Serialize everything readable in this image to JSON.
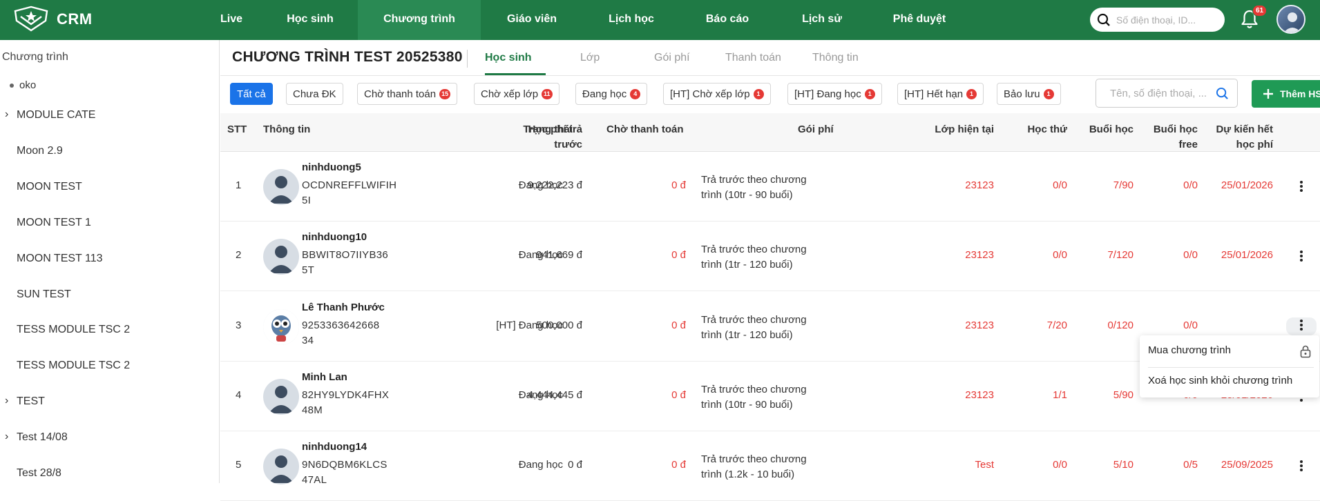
{
  "app": {
    "brand": "CRM"
  },
  "nav": {
    "items": [
      {
        "label": "Live"
      },
      {
        "label": "Học sinh"
      },
      {
        "label": "Chương trình"
      },
      {
        "label": "Giáo viên"
      },
      {
        "label": "Lịch học"
      },
      {
        "label": "Báo cáo"
      },
      {
        "label": "Lịch sử"
      },
      {
        "label": "Phê duyệt"
      }
    ],
    "active": "Chương trình",
    "search_placeholder": "Số điện thoại, ID...",
    "notification_count": "61"
  },
  "sidebar": {
    "title": "Chương trình",
    "sub": "oko",
    "items": [
      {
        "label": "MODULE CATE",
        "expandable": true
      },
      {
        "label": "Moon 2.9",
        "expandable": false
      },
      {
        "label": "MOON TEST",
        "expandable": false
      },
      {
        "label": "MOON TEST 1",
        "expandable": false
      },
      {
        "label": "MOON TEST 113",
        "expandable": false
      },
      {
        "label": "SUN TEST",
        "expandable": false
      },
      {
        "label": "TESS MODULE TSC 2",
        "expandable": false
      },
      {
        "label": "TESS MODULE TSC 2",
        "expandable": false
      },
      {
        "label": "TEST",
        "expandable": true
      },
      {
        "label": "Test 14/08",
        "expandable": true
      },
      {
        "label": "Test 28/8",
        "expandable": false
      }
    ]
  },
  "program": {
    "title": "CHƯƠNG TRÌNH TEST 20525380",
    "tabs": [
      {
        "label": "Học sinh"
      },
      {
        "label": "Lớp"
      },
      {
        "label": "Gói phí"
      },
      {
        "label": "Thanh toán"
      },
      {
        "label": "Thông tin"
      }
    ],
    "active_tab": "Học sinh"
  },
  "filters": [
    {
      "label": "Tất cả",
      "count": ""
    },
    {
      "label": "Chưa ĐK",
      "count": ""
    },
    {
      "label": "Chờ thanh toán",
      "count": "15"
    },
    {
      "label": "Chờ xếp lớp",
      "count": "11"
    },
    {
      "label": "Đang học",
      "count": "4"
    },
    {
      "label": "[HT] Chờ xếp lớp",
      "count": "1"
    },
    {
      "label": "[HT] Đang học",
      "count": "1"
    },
    {
      "label": "[HT] Hết hạn",
      "count": "1"
    },
    {
      "label": "Bảo lưu",
      "count": "1"
    }
  ],
  "table_search": {
    "placeholder": "Tên, số điện thoại, ..."
  },
  "add_button": {
    "label": "Thêm HS"
  },
  "table": {
    "headers": {
      "stt": "STT",
      "info": "Thông tin",
      "status": "Trạng thái",
      "prepaid_1": "Học phí trả",
      "prepaid_2": "trước",
      "pending": "Chờ thanh toán",
      "package": "Gói phí",
      "class": "Lớp hiện tại",
      "nth": "Học thứ",
      "sessions": "Buổi học",
      "free_1": "Buổi học",
      "free_2": "free",
      "expected_1": "Dự kiến hết",
      "expected_2": "học phí"
    },
    "rows": [
      {
        "stt": "1",
        "name": "ninhduong5",
        "code1": "OCDNREFFLWIFIH",
        "code2": "5I",
        "status": "Đang học",
        "prepaid": "9,222,223 đ",
        "pending": "0 đ",
        "pkg1": "Trả trước theo chương",
        "pkg2": "trình (10tr - 90 buổi)",
        "class": "23123",
        "nth": "0/0",
        "sessions": "7/90",
        "free": "0/0",
        "expected": "25/01/2026"
      },
      {
        "stt": "2",
        "name": "ninhduong10",
        "code1": "BBWIT8O7IIYB36",
        "code2": "5T",
        "status": "Đang học",
        "prepaid": "941,669 đ",
        "pending": "0 đ",
        "pkg1": "Trả trước theo chương",
        "pkg2": "trình (1tr - 120 buổi)",
        "class": "23123",
        "nth": "0/0",
        "sessions": "7/120",
        "free": "0/0",
        "expected": "25/01/2026"
      },
      {
        "stt": "3",
        "name": "Lê Thanh Phước",
        "code1": "9253363642668",
        "code2": "34",
        "status": "[HT] Đang học",
        "prepaid": "500,000 đ",
        "pending": "0 đ",
        "pkg1": "Trả trước theo chương",
        "pkg2": "trình (1tr - 120 buổi)",
        "class": "23123",
        "nth": "7/20",
        "sessions": "0/120",
        "free": "0/0",
        "expected": ""
      },
      {
        "stt": "4",
        "name": "Minh Lan",
        "code1": "82HY9LYDK4FHX",
        "code2": "48M",
        "status": "Đang học",
        "prepaid": "4,444,445 đ",
        "pending": "0 đ",
        "pkg1": "Trả trước theo chương",
        "pkg2": "trình (10tr - 90 buổi)",
        "class": "23123",
        "nth": "1/1",
        "sessions": "5/90",
        "free": "0/0",
        "expected": "25/01/2026"
      },
      {
        "stt": "5",
        "name": "ninhduong14",
        "code1": "9N6DQBM6KLCS",
        "code2": "47AL",
        "status": "Đang học",
        "prepaid": "0 đ",
        "pending": "0 đ",
        "pkg1": "Trả trước theo chương",
        "pkg2": "trình (1.2k - 10 buổi)",
        "class": "Test",
        "nth": "0/0",
        "sessions": "5/10",
        "free": "0/5",
        "expected": "25/09/2025"
      }
    ]
  },
  "context_menu": {
    "items": [
      {
        "label": "Mua chương trình"
      },
      {
        "label": "Xoá học sinh khỏi chương trình"
      }
    ]
  },
  "colors": {
    "brand_green": "#1f7a45",
    "active_blue": "#1a73e8",
    "alert_red": "#e53935"
  }
}
